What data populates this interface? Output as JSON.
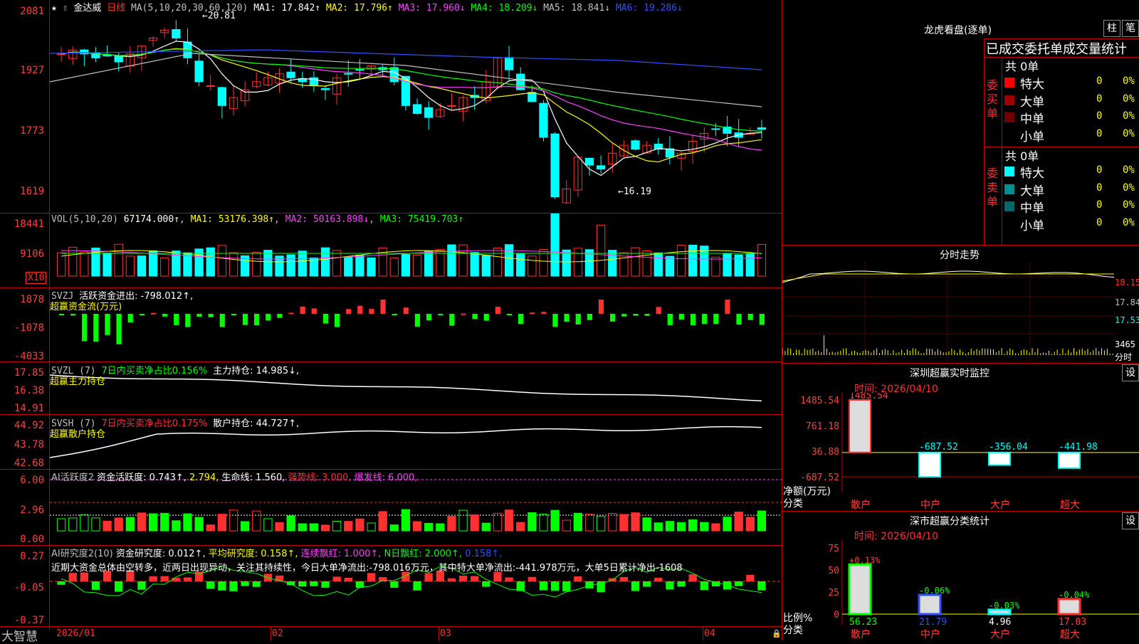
{
  "main": {
    "stock_name": "金达威",
    "period": "日线",
    "ma_params": "MA(5,10,20,30,60,120)",
    "ma": [
      {
        "label": "MA1: 17.842",
        "arrow": "↑",
        "color": "#ffffff"
      },
      {
        "label": "MA2: 17.796",
        "arrow": "↑",
        "color": "#ffff00"
      },
      {
        "label": "MA3: 17.960",
        "arrow": "↓",
        "color": "#ff40ff"
      },
      {
        "label": "MA4: 18.209",
        "arrow": "↓",
        "color": "#00ff00"
      },
      {
        "label": "MA5: 18.841",
        "arrow": "↓",
        "color": "#c0c0c0"
      },
      {
        "label": "MA6: 19.286",
        "arrow": "↓",
        "color": "#3050ff"
      }
    ],
    "y_ticks": [
      "2081",
      "1927",
      "1773",
      "1619"
    ],
    "high_label": "20.81",
    "low_label": "16.19"
  },
  "vol": {
    "title": "VOL(5,10,20)",
    "value": "67174.000↑",
    "ma1": "MA1: 53176.398↑",
    "ma2": "MA2: 50163.898↓",
    "ma3": "MA3: 75419.703↑",
    "y_ticks": [
      "18441",
      "9106"
    ],
    "unit": "X10"
  },
  "svzj": {
    "title": "SVZJ",
    "label": "活跃资金进出: -798.012↑,",
    "subtitle": "超赢资金流(万元)",
    "y_ticks": [
      "1878",
      "-1078",
      "-4033"
    ]
  },
  "svzl": {
    "title": "SVZL (7)",
    "label1": "7日内买卖净占比0.156%",
    "label2": "主力持仓: 14.985↓,",
    "subtitle": "超赢主力持仓",
    "y_ticks": [
      "17.85",
      "16.38",
      "14.91"
    ]
  },
  "svsh": {
    "title": "SVSH (7)",
    "label1": "7日内买卖净占比0.175%",
    "label2": "散户持仓: 44.727↑,",
    "subtitle": "超赢散户持仓",
    "y_ticks": [
      "44.92",
      "43.78",
      "42.68"
    ]
  },
  "ai1": {
    "title": "AI活跃度2",
    "l1": "资金活跃度: 0.743↑,",
    "l2": "2.794,",
    "l3": "生命线: 1.560,",
    "l4": "强势线: 3.000,",
    "l5": "爆发线: 6.000,",
    "y_ticks": [
      "6.00",
      "2.96",
      "0.00"
    ]
  },
  "ai2": {
    "title": "AI研究度2(10)",
    "l1": "资金研究度: 0.012↑,",
    "l2": "平均研究度: 0.158↑,",
    "l3": "连续飘红: 1.000↑,",
    "l4": "N日飘红: 2.000↑,",
    "l5": "0.158↑,",
    "note": "近期大资金总体由空转多，近两日出现异动，关注其持续性，今日大单净流出:-798.016万元，其中特大单净流出:-441.978万元，大单5日累计净出-1608",
    "y_ticks": [
      "0.27",
      "-0.05",
      "-0.37"
    ]
  },
  "xaxis": {
    "brand": "大智慧",
    "labels": [
      "2026/01",
      "02",
      "03",
      "04"
    ]
  },
  "right": {
    "lhb_title": "龙虎看盘(逐单)",
    "btn_zhu": "柱",
    "btn_bi": "笔",
    "table_header": "已成交委托单成交量统计",
    "buy_label": "委买单",
    "sell_label": "委卖单",
    "buy_total": "共 0单",
    "sell_total": "共 0单",
    "buy_rows": [
      {
        "name": "特大",
        "val": "0",
        "pct": "0%",
        "color": "#ff0000"
      },
      {
        "name": "大单",
        "val": "0",
        "pct": "0%",
        "color": "#a00000"
      },
      {
        "name": "中单",
        "val": "0",
        "pct": "0%",
        "color": "#700000"
      },
      {
        "name": "小单",
        "val": "0",
        "pct": "0%",
        "color": ""
      }
    ],
    "sell_rows": [
      {
        "name": "特大",
        "val": "0",
        "pct": "0%",
        "color": "#00ffff"
      },
      {
        "name": "大单",
        "val": "0",
        "pct": "0%",
        "color": "#009090"
      },
      {
        "name": "中单",
        "val": "0",
        "pct": "0%",
        "color": "#006868"
      },
      {
        "name": "小单",
        "val": "0",
        "pct": "0%",
        "color": ""
      }
    ],
    "fenshi_title": "分时走势",
    "fenshi_ticks": [
      "18.15",
      "17.84",
      "17.53",
      "3465",
      "分时"
    ],
    "monitor_title": "深圳超赢实时监控",
    "monitor_btn": "设",
    "monitor_time": "时间: 2026/04/10",
    "monitor_y": [
      "1485.54",
      "761.18",
      "36.88",
      "-687.52"
    ],
    "monitor_ylabel": "净额(万元)",
    "monitor_xlabel": "分类",
    "classify_title": "深市超赢分类统计",
    "classify_btn": "设",
    "classify_time": "时间: 2026/04/10",
    "classify_y": [
      "75",
      "50",
      "25",
      "0"
    ],
    "classify_ylabel": "比例%",
    "classify_xlabel": "分类"
  },
  "chart_data": [
    {
      "type": "bar",
      "title": "深圳超赢实时监控",
      "ylabel": "净额(万元)",
      "categories": [
        "散户",
        "中户",
        "大户",
        "超大"
      ],
      "values": [
        1485.54,
        -687.52,
        -356.04,
        -441.98
      ],
      "labels": [
        "1485.54",
        "-687.52",
        "-356.04",
        "-441.98"
      ],
      "ylim": [
        -687.52,
        1485.54
      ]
    },
    {
      "type": "bar",
      "title": "深市超赢分类统计",
      "ylabel": "比例%",
      "categories": [
        "散户",
        "中户",
        "大户",
        "超大"
      ],
      "values": [
        56.23,
        21.79,
        4.96,
        17.03
      ],
      "change_labels": [
        "+0.13%",
        "-0.06%",
        "-0.03%",
        "-0.04%"
      ],
      "value_labels": [
        "56.23",
        "21.79",
        "4.96",
        "17.03"
      ],
      "ylim": [
        0,
        75
      ]
    }
  ]
}
